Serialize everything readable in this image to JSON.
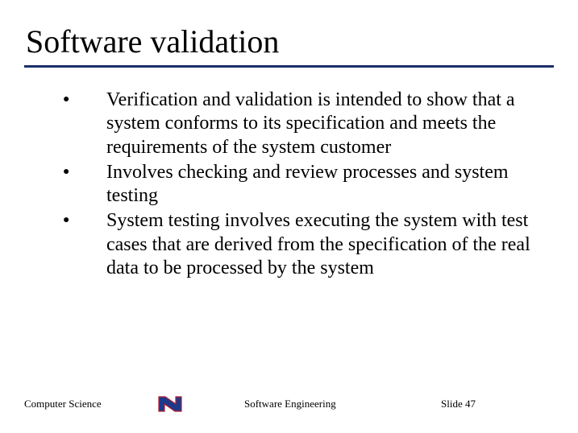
{
  "title": "Software validation",
  "bullets": [
    "Verification and validation is intended to show that a system conforms to its specification and meets the requirements of the system customer",
    "Involves checking and review processes and system testing",
    "System testing involves executing the system with test cases that are derived from the specification of the real data to be processed by the system"
  ],
  "footer": {
    "left": "Computer Science",
    "center": "Software Engineering",
    "slide_label": "Slide",
    "slide_number": "47"
  },
  "colors": {
    "rule": "#1a2e6b",
    "logo_fill": "#1d3a8a",
    "logo_stroke": "#b01c2e"
  }
}
